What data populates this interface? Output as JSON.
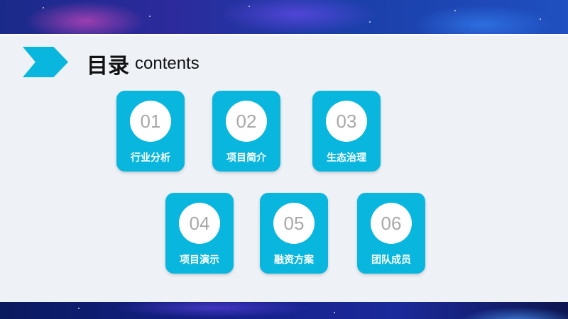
{
  "header": {
    "title": "目录",
    "subtitle": "contents"
  },
  "items": [
    {
      "number": "01",
      "label": "行业分析"
    },
    {
      "number": "02",
      "label": "项目简介"
    },
    {
      "number": "03",
      "label": "生态治理"
    },
    {
      "number": "04",
      "label": "项目演示"
    },
    {
      "number": "05",
      "label": "融资方案"
    },
    {
      "number": "06",
      "label": "团队成员"
    }
  ],
  "colors": {
    "accent": "#08b6de",
    "panel": "#eef2f6",
    "number_text": "#a8a8a8"
  }
}
